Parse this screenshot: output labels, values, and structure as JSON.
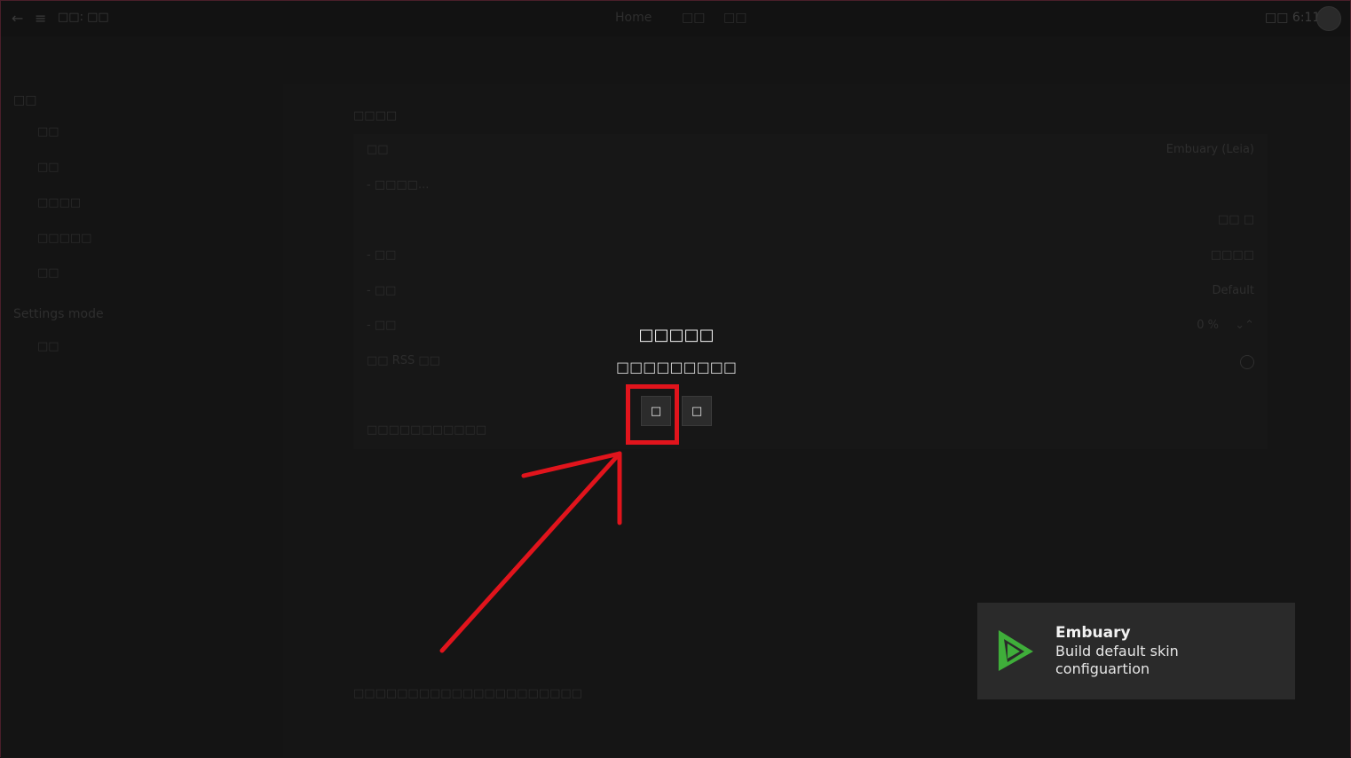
{
  "topbar": {
    "back_icon": "←",
    "menu_icon": "≡",
    "title": "□□: □□",
    "nav": [
      "Home",
      "□□",
      "□□"
    ],
    "clock": "□□ 6:11"
  },
  "sidebar": {
    "section1": "□□",
    "items": [
      "□□",
      "□□",
      "□□□□",
      "□□□□□",
      "□□"
    ],
    "section2": "Settings mode",
    "items2": [
      "□□"
    ]
  },
  "main": {
    "group_label": "□□□□",
    "rows": [
      {
        "label": "□□",
        "value": "Embuary (Leia)"
      },
      {
        "label": "- □□□□...",
        "value": ""
      },
      {
        "label": "",
        "value": "□□ □"
      },
      {
        "label": "- □□",
        "value": "□□□□"
      },
      {
        "label": "- □□",
        "value": "Default"
      },
      {
        "label": "- □□",
        "value": "0 %"
      },
      {
        "label": "□□ RSS □□",
        "value": ""
      },
      {
        "label": "",
        "value": ""
      },
      {
        "label": "□□□□□□□□□□□",
        "value": ""
      }
    ],
    "footer_note": "□□□□□□□□□□□□□□□□□□□□□"
  },
  "dialog": {
    "title": "□□□□□",
    "message": "□□□□□□□□□",
    "yes_label": "□",
    "no_label": "□"
  },
  "toast": {
    "title": "Embuary",
    "message": "Build default skin configuartion",
    "icon": "play-triangle-icon",
    "icon_color": "#3fae3a"
  },
  "annotation": {
    "color": "#e1141c"
  }
}
